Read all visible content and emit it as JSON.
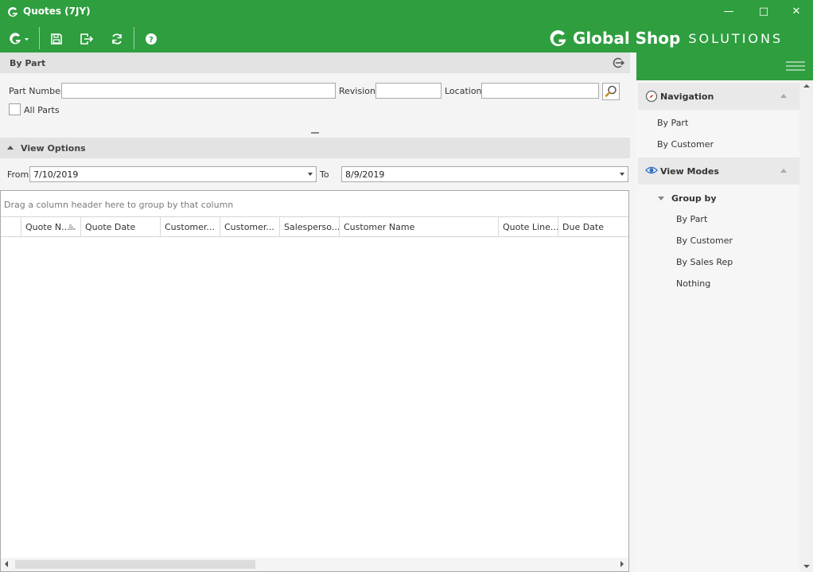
{
  "window": {
    "title": "Quotes (7JY)",
    "minimize": "—",
    "maximize": "□",
    "close": "✕"
  },
  "toolbar": {
    "buttons": [
      "g-menu-icon",
      "save-icon",
      "exit-icon",
      "refresh-icon",
      "help-icon"
    ]
  },
  "brand": {
    "name": "Global Shop",
    "suffix": "SOLUTIONS"
  },
  "by_part": {
    "header": "By Part",
    "part_number_label": "Part Number",
    "part_number_value": "",
    "revision_label": "Revision",
    "revision_value": "",
    "location_label": "Location",
    "location_value": "",
    "all_parts_label": "All Parts",
    "all_parts_checked": false
  },
  "view_options": {
    "header": "View Options",
    "from_label": "From",
    "from_value": "7/10/2019",
    "to_label": "To",
    "to_value": "8/9/2019"
  },
  "grid": {
    "group_hint": "Drag a column header here to group by that column",
    "columns": [
      "Quote N...",
      "Quote Date",
      "Customer...",
      "Customer...",
      "Salesperso...",
      "Customer Name",
      "Quote Line...",
      "Due Date"
    ],
    "rows": []
  },
  "sidebar": {
    "navigation": {
      "header": "Navigation",
      "items": [
        "By Part",
        "By Customer"
      ]
    },
    "view_modes": {
      "header": "View Modes",
      "group_by_label": "Group by",
      "items": [
        "By Part",
        "By Customer",
        "By Sales Rep",
        "Nothing"
      ]
    }
  },
  "colors": {
    "brand_green": "#2e9e3f",
    "panel_bg": "#f4f4f4",
    "header_bg": "#e3e3e3"
  }
}
